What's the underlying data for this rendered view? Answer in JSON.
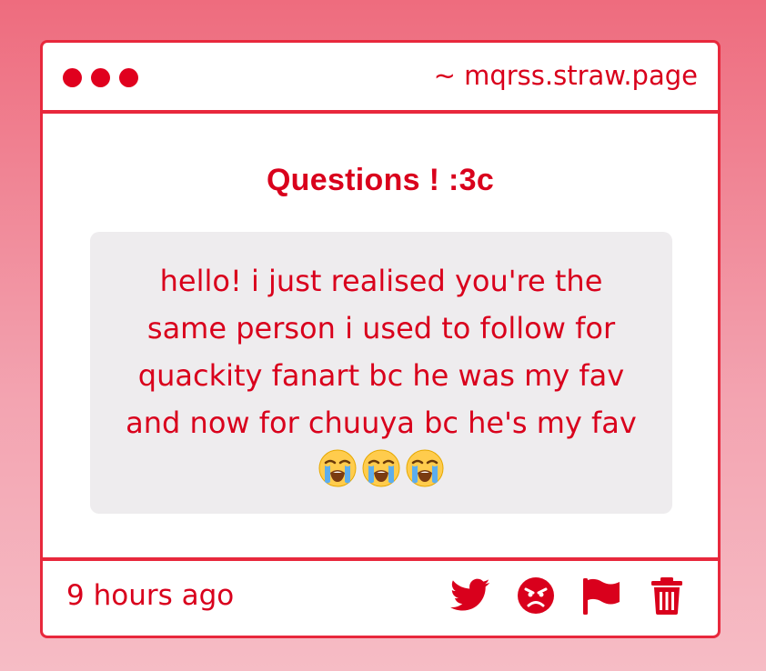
{
  "window": {
    "url": "~ mqrss.straw.page"
  },
  "card": {
    "title": "Questions ! :3c",
    "message": "hello! i just realised you're the\nsame person i used to follow for\nquackity fanart bc he was my fav\nand now for chuuya bc he's my fav",
    "emoji": [
      "loudly-crying-face",
      "loudly-crying-face",
      "loudly-crying-face"
    ]
  },
  "footer": {
    "timestamp": "9 hours ago",
    "actions": [
      "twitter-icon",
      "angry-face-icon",
      "flag-icon",
      "trash-icon"
    ]
  },
  "colors": {
    "accent": "#e8283c",
    "text": "#d9001c",
    "message_bg": "#eeecee"
  }
}
